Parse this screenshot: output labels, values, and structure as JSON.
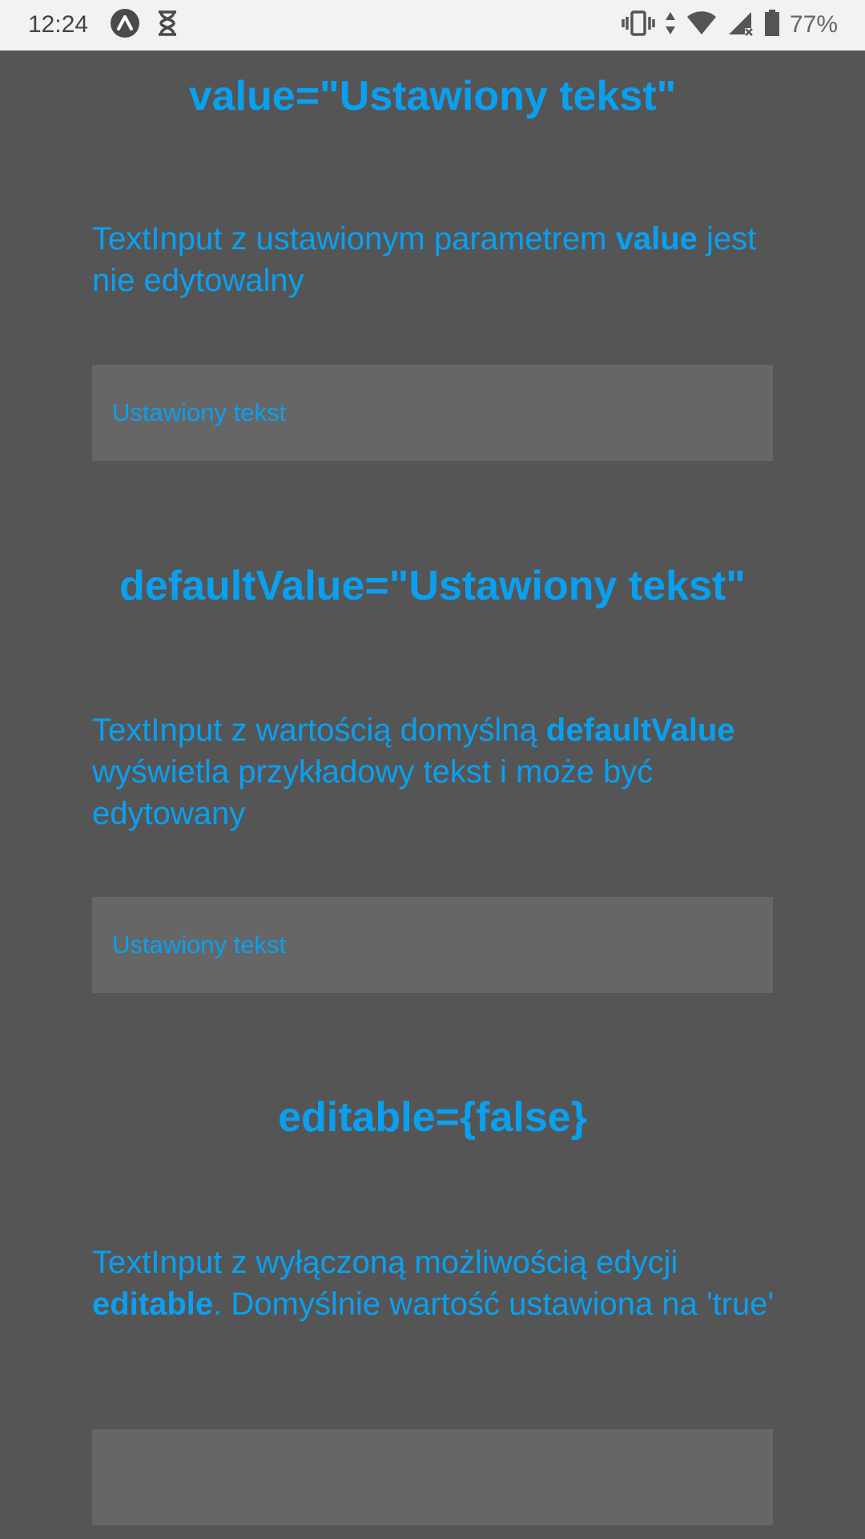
{
  "status_bar": {
    "time": "12:24",
    "battery": "77%",
    "icons": [
      "app-a-icon",
      "hourglass-icon",
      "vibrate-icon",
      "data-arrows-icon",
      "wifi-icon",
      "cell-signal-icon",
      "battery-icon"
    ]
  },
  "sections": [
    {
      "heading": "value=\"Ustawiony tekst\"",
      "desc_before": "TextInput z ustawionym parametrem ",
      "desc_bold": "value",
      "desc_after": " jest nie edytowalny",
      "field_value": "Ustawiony tekst"
    },
    {
      "heading": "defaultValue=\"Ustawiony tekst\"",
      "desc_before": "TextInput z wartością domyślną ",
      "desc_bold": "defaultValue",
      "desc_after": " wyświetla przykładowy tekst i może być edytowany",
      "field_value": "Ustawiony tekst"
    },
    {
      "heading": "editable={false}",
      "desc_before": "TextInput z wyłączoną możliwością edycji ",
      "desc_bold": "editable",
      "desc_after": ". Domyślnie wartość ustawiona na 'true'",
      "field_value": ""
    }
  ],
  "colors": {
    "background": "#555555",
    "field_background": "#666666",
    "accent": "#0aa0f0",
    "status_bar": "#f2f2f2"
  }
}
